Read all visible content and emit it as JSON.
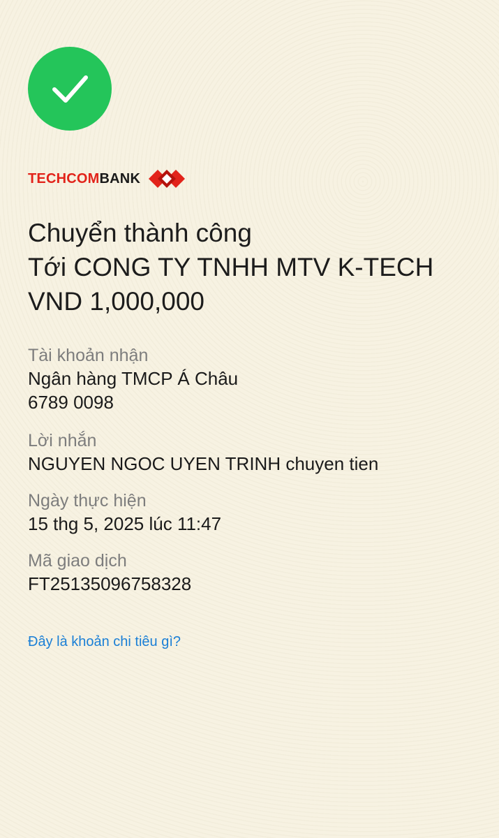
{
  "icons": {
    "success": "checkmark-circle-icon",
    "logo_mark": "techcombank-diamond-logo"
  },
  "colors": {
    "success": "#24c55a",
    "brand_red": "#e2231a",
    "link": "#1a7fd6",
    "background": "#f7f2e2"
  },
  "brand": {
    "name_part_red": "TECHCOM",
    "name_part_black": "BANK"
  },
  "headline": {
    "status": "Chuyển thành công",
    "recipient": "Tới CONG TY TNHH MTV K-TECH",
    "amount": "VND 1,000,000"
  },
  "details": {
    "receiving_account_label": "Tài khoản nhận",
    "bank_name": "Ngân hàng TMCP Á Châu",
    "account_number": "6789 0098",
    "message_label": "Lời nhắn",
    "message": "NGUYEN NGOC UYEN TRINH chuyen tien",
    "date_label": "Ngày thực hiện",
    "date": "15 thg 5, 2025 lúc 11:47",
    "transaction_id_label": "Mã giao dịch",
    "transaction_id": "FT25135096758328"
  },
  "actions": {
    "spending_category_link": "Đây là khoản chi tiêu gì?"
  }
}
